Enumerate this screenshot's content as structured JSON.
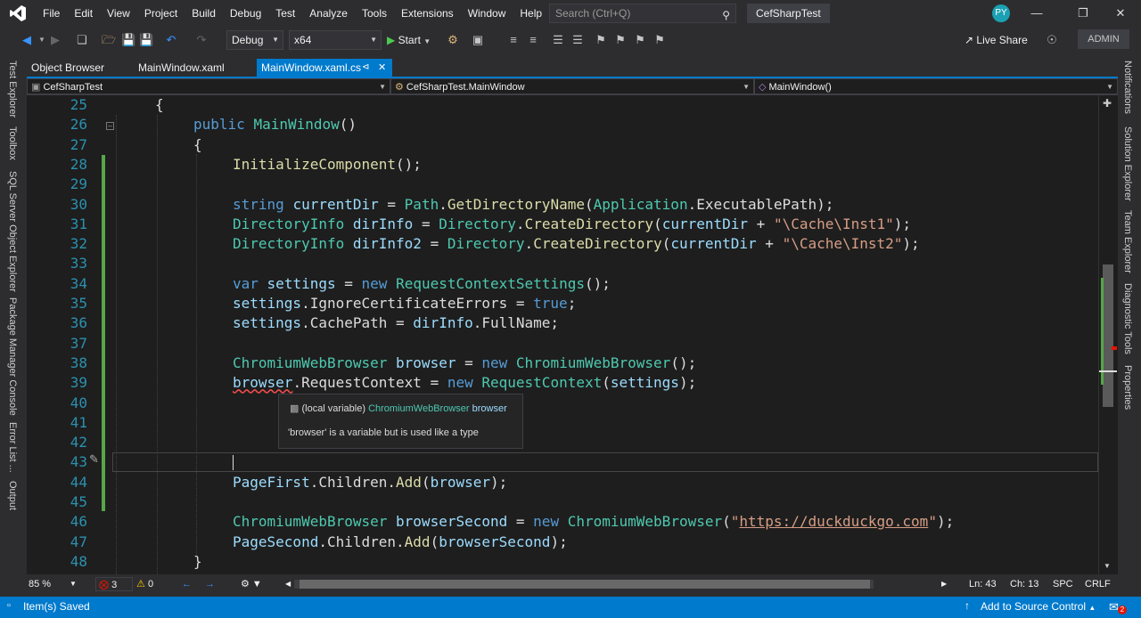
{
  "menubar": {
    "items": [
      "File",
      "Edit",
      "View",
      "Project",
      "Build",
      "Debug",
      "Test",
      "Analyze",
      "Tools",
      "Extensions",
      "Window",
      "Help"
    ],
    "search_placeholder": "Search (Ctrl+Q)",
    "solution_title": "CefSharpTest",
    "avatar_initials": "PY"
  },
  "toolbar": {
    "config": "Debug",
    "platform": "x64",
    "start_label": "Start",
    "live_share_label": "Live Share",
    "admin_label": "ADMIN"
  },
  "left_rail": {
    "tabs": [
      "Test Explorer",
      "Toolbox",
      "SQL Server Object Explorer",
      "Package Manager Console",
      "Error List ...",
      "Output"
    ]
  },
  "right_rail": {
    "tabs": [
      "Notifications",
      "Solution Explorer",
      "Team Explorer",
      "Diagnostic Tools",
      "Properties"
    ]
  },
  "doc_tabs": [
    {
      "label": "Object Browser",
      "active": false
    },
    {
      "label": "MainWindow.xaml",
      "active": false
    },
    {
      "label": "MainWindow.xaml.cs",
      "active": true
    }
  ],
  "navbar": {
    "project": "CefSharpTest",
    "class": "CefSharpTest.MainWindow",
    "member": "MainWindow()"
  },
  "editor": {
    "line_numbers": [
      "25",
      "26",
      "27",
      "28",
      "29",
      "30",
      "31",
      "32",
      "33",
      "34",
      "35",
      "36",
      "37",
      "38",
      "39",
      "40",
      "41",
      "42",
      "43",
      "44",
      "45",
      "46",
      "47",
      "48"
    ],
    "current_line": "43"
  },
  "tooltip": {
    "kind": "(local variable)",
    "type_name": "ChromiumWebBrowser",
    "var_name": "browser",
    "message": "'browser' is a variable but is used like a type"
  },
  "editor_bottom": {
    "zoom": "85 %",
    "errors": "3",
    "warnings": "0",
    "ln": "Ln: 43",
    "ch": "Ch: 13",
    "spc": "SPC",
    "crlf": "CRLF"
  },
  "statusbar": {
    "message": "Item(s) Saved",
    "source_control": "Add to Source Control",
    "notifications": "2"
  },
  "colors": {
    "accent": "#007acc",
    "keyword": "#569cd6",
    "type": "#4ec9b0",
    "identifier": "#9cdcfe",
    "method": "#dcdcaa",
    "string": "#d69d85",
    "line_number": "#2b91af"
  }
}
